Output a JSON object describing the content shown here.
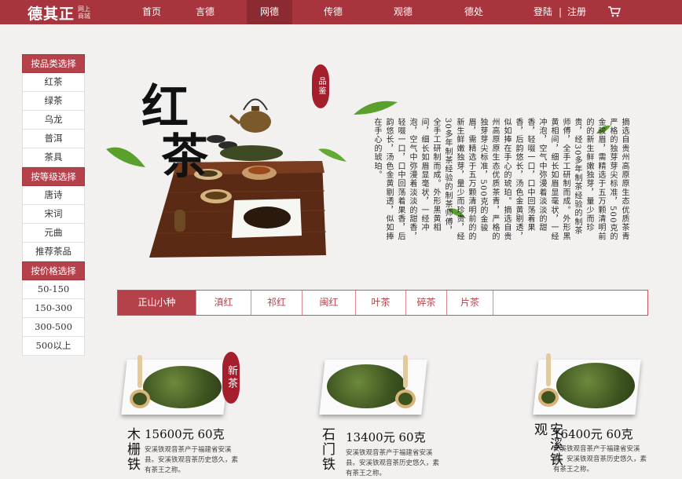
{
  "brand": {
    "logo_text": "德其正",
    "logo_sub": "网上商城"
  },
  "nav": {
    "items": [
      "首页",
      "言德",
      "网德",
      "传德",
      "观德",
      "德处"
    ],
    "active": "网德",
    "login": "登陆",
    "separator": "|",
    "register": "注册"
  },
  "sidebar": {
    "groups": [
      {
        "title": "按品类选择",
        "items": [
          "红茶",
          "绿茶",
          "乌龙",
          "普洱",
          "茶具"
        ]
      },
      {
        "title": "按等级选择",
        "items": [
          "唐诗",
          "宋词",
          "元曲",
          "推荐茶品"
        ]
      },
      {
        "title": "按价格选择",
        "items": [
          "50-150",
          "150-300",
          "300-500",
          "500以上"
        ]
      }
    ]
  },
  "hero": {
    "calligraphy": "红茶",
    "seal_text": "品鉴",
    "description": "摘选自贵州高原原生态优质茶青严格的独芽芽尖标准，500克的金骏眉，需精选于五万颗清明前的的新生鲜嫩独芽，量少而珍贵，经30多年制茶经验的制茶师傅，全手工研制而成。外形黑黄相间，细长如眉显毫状，一经冲泡，空气中弥漫着淡淡的甜香，轻啜一口，口中回荡着果香，后韵悠长，汤色金黄剔透，似如捧在手心的琥珀。摘选自贵州高原原生态优质茶青，严格的独芽芽尖标准，500克的金骏眉，需精选于五万颗清明前的的新生鲜嫩独芽，量少而珍贵，经30多年制茶经验的制茶师傅，全手工研制而成。外形黑黄相间，细长如眉显毫状，一经冲泡，空气中弥漫着淡淡的甜香，轻啜一口，口中回荡着果香，后韵悠长，汤色金黄剔透，似如捧在手心的琥珀。"
  },
  "tabs": {
    "items": [
      "正山小种",
      "滇红",
      "祁红",
      "闽红",
      "叶茶",
      "碎茶",
      "片茶"
    ],
    "active": "正山小种"
  },
  "products": [
    {
      "name": "木栅铁",
      "price": "15600元  60克",
      "badge": "新茶",
      "desc": "安溪铁观音茶产于福建省安溪县。安溪铁观音茶历史悠久，素有茶王之称。"
    },
    {
      "name": "石门铁",
      "price": "13400元  60克",
      "badge": "",
      "desc": "安溪铁观音茶产于福建省安溪县。安溪铁观音茶历史悠久，素有茶王之称。"
    },
    {
      "name": "安溪铁观",
      "price": "16400元  60克",
      "badge": "",
      "desc": "安溪铁观音茶产于福建省安溪县。安溪铁观音茶历史悠久，素有茶王之称。"
    }
  ],
  "colors": {
    "brand_red": "#a8353d",
    "accent_red": "#b5424a",
    "seal_red": "#a41f2b"
  },
  "icons": {
    "cart": "cart-icon",
    "seal": "seal-badge",
    "leaf": "tea-leaf-icon"
  }
}
